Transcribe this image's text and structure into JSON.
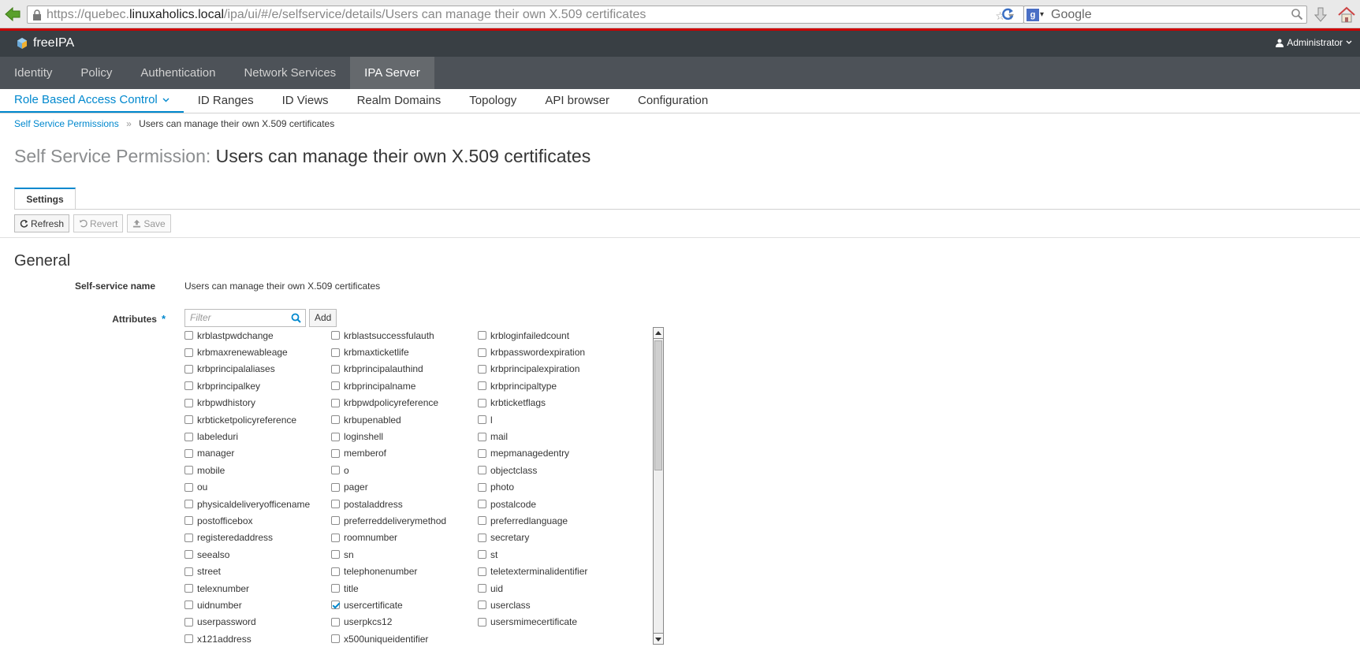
{
  "browser": {
    "url_scheme": "https://quebec.",
    "url_host": "linuxaholics.local",
    "url_path": "/ipa/ui/#/e/selfservice/details/Users can manage their own X.509 certificates",
    "search_engine": "Google"
  },
  "header": {
    "brand": "freeIPA",
    "user": "Administrator"
  },
  "main_nav": {
    "items": [
      "Identity",
      "Policy",
      "Authentication",
      "Network Services",
      "IPA Server"
    ],
    "active": "IPA Server"
  },
  "sub_nav": {
    "items": [
      "Role Based Access Control",
      "ID Ranges",
      "ID Views",
      "Realm Domains",
      "Topology",
      "API browser",
      "Configuration"
    ],
    "active": "Role Based Access Control"
  },
  "breadcrumb": {
    "parent": "Self Service Permissions",
    "separator": "»",
    "current": "Users can manage their own X.509 certificates"
  },
  "page": {
    "title_label": "Self Service Permission:",
    "title_value": "Users can manage their own X.509 certificates"
  },
  "tabs": {
    "settings": "Settings"
  },
  "toolbar": {
    "refresh": "Refresh",
    "revert": "Revert",
    "save": "Save"
  },
  "section": {
    "general": "General"
  },
  "fields": {
    "name_label": "Self-service name",
    "name_value": "Users can manage their own X.509 certificates",
    "attributes_label": "Attributes",
    "required_mark": "*",
    "filter_placeholder": "Filter",
    "add_label": "Add"
  },
  "attributes": [
    {
      "name": "krblastpwdchange",
      "checked": false
    },
    {
      "name": "krblastsuccessfulauth",
      "checked": false
    },
    {
      "name": "krbloginfailedcount",
      "checked": false
    },
    {
      "name": "krbmaxrenewableage",
      "checked": false
    },
    {
      "name": "krbmaxticketlife",
      "checked": false
    },
    {
      "name": "krbpasswordexpiration",
      "checked": false
    },
    {
      "name": "krbprincipalaliases",
      "checked": false
    },
    {
      "name": "krbprincipalauthind",
      "checked": false
    },
    {
      "name": "krbprincipalexpiration",
      "checked": false
    },
    {
      "name": "krbprincipalkey",
      "checked": false
    },
    {
      "name": "krbprincipalname",
      "checked": false
    },
    {
      "name": "krbprincipaltype",
      "checked": false
    },
    {
      "name": "krbpwdhistory",
      "checked": false
    },
    {
      "name": "krbpwdpolicyreference",
      "checked": false
    },
    {
      "name": "krbticketflags",
      "checked": false
    },
    {
      "name": "krbticketpolicyreference",
      "checked": false
    },
    {
      "name": "krbupenabled",
      "checked": false
    },
    {
      "name": "l",
      "checked": false
    },
    {
      "name": "labeleduri",
      "checked": false
    },
    {
      "name": "loginshell",
      "checked": false
    },
    {
      "name": "mail",
      "checked": false
    },
    {
      "name": "manager",
      "checked": false
    },
    {
      "name": "memberof",
      "checked": false
    },
    {
      "name": "mepmanagedentry",
      "checked": false
    },
    {
      "name": "mobile",
      "checked": false
    },
    {
      "name": "o",
      "checked": false
    },
    {
      "name": "objectclass",
      "checked": false
    },
    {
      "name": "ou",
      "checked": false
    },
    {
      "name": "pager",
      "checked": false
    },
    {
      "name": "photo",
      "checked": false
    },
    {
      "name": "physicaldeliveryofficename",
      "checked": false
    },
    {
      "name": "postaladdress",
      "checked": false
    },
    {
      "name": "postalcode",
      "checked": false
    },
    {
      "name": "postofficebox",
      "checked": false
    },
    {
      "name": "preferreddeliverymethod",
      "checked": false
    },
    {
      "name": "preferredlanguage",
      "checked": false
    },
    {
      "name": "registeredaddress",
      "checked": false
    },
    {
      "name": "roomnumber",
      "checked": false
    },
    {
      "name": "secretary",
      "checked": false
    },
    {
      "name": "seealso",
      "checked": false
    },
    {
      "name": "sn",
      "checked": false
    },
    {
      "name": "st",
      "checked": false
    },
    {
      "name": "street",
      "checked": false
    },
    {
      "name": "telephonenumber",
      "checked": false
    },
    {
      "name": "teletexterminalidentifier",
      "checked": false
    },
    {
      "name": "telexnumber",
      "checked": false
    },
    {
      "name": "title",
      "checked": false
    },
    {
      "name": "uid",
      "checked": false
    },
    {
      "name": "uidnumber",
      "checked": false
    },
    {
      "name": "usercertificate",
      "checked": true
    },
    {
      "name": "userclass",
      "checked": false
    },
    {
      "name": "userpassword",
      "checked": false
    },
    {
      "name": "userpkcs12",
      "checked": false
    },
    {
      "name": "usersmimecertificate",
      "checked": false
    },
    {
      "name": "x121address",
      "checked": false
    },
    {
      "name": "x500uniqueidentifier",
      "checked": false
    }
  ],
  "colors": {
    "accent": "#0088ce",
    "header_bg": "#393f44",
    "nav_bg": "#4d5258",
    "nav_active_bg": "#65696d",
    "top_line": "#cc0000"
  }
}
